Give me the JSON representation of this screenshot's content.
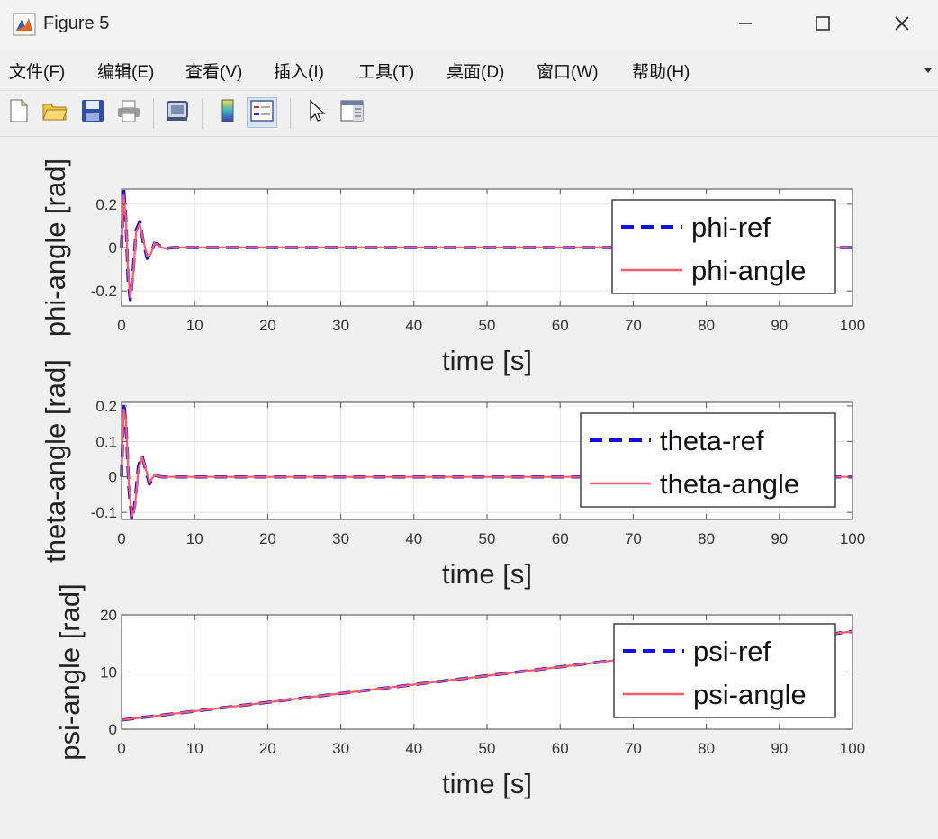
{
  "window": {
    "title": "Figure 5",
    "controls": {
      "minimize": "minimize-icon",
      "maximize": "maximize-icon",
      "close": "close-icon"
    }
  },
  "menu": [
    {
      "label": "文件(F)"
    },
    {
      "label": "编辑(E)"
    },
    {
      "label": "查看(V)"
    },
    {
      "label": "插入(I)"
    },
    {
      "label": "工具(T)"
    },
    {
      "label": "桌面(D)"
    },
    {
      "label": "窗口(W)"
    },
    {
      "label": "帮助(H)"
    }
  ],
  "toolbar": [
    {
      "icon": "new-figure-icon"
    },
    {
      "icon": "open-file-icon"
    },
    {
      "icon": "save-icon"
    },
    {
      "icon": "print-icon"
    },
    {
      "icon": "link-plot-icon"
    },
    {
      "icon": "insert-colorbar-icon"
    },
    {
      "icon": "insert-legend-icon",
      "pressed": true
    },
    {
      "icon": "edit-plot-icon"
    },
    {
      "icon": "open-property-inspector-icon"
    }
  ],
  "colors": {
    "ref": "#1010e0",
    "actual": "#ff5a6e",
    "axis": "#333333"
  },
  "chart_data": [
    {
      "type": "line",
      "xlabel": "time [s]",
      "ylabel": "phi-angle [rad]",
      "xlim": [
        0,
        100
      ],
      "ylim": [
        -0.27,
        0.27
      ],
      "xticks": [
        "0",
        "10",
        "20",
        "30",
        "40",
        "50",
        "60",
        "70",
        "80",
        "90",
        "100"
      ],
      "yticks": [
        {
          "v": 0.2,
          "t": "0.2"
        },
        {
          "v": 0,
          "t": "0"
        },
        {
          "v": -0.2,
          "t": "-0.2"
        }
      ],
      "grid": true,
      "legend_position": "top-right",
      "series": [
        {
          "name": "phi-ref",
          "style": "dashed",
          "color": "#1010e0",
          "x": [
            0,
            0.3,
            0.6,
            0.9,
            1.2,
            1.6,
            2,
            2.5,
            3,
            3.5,
            4,
            4.5,
            5,
            5.5,
            6,
            7,
            8,
            100
          ],
          "y": [
            0,
            0.27,
            0.12,
            -0.15,
            -0.24,
            -0.1,
            0.08,
            0.12,
            0.02,
            -0.05,
            -0.03,
            0.02,
            0.015,
            0,
            -0.005,
            0,
            0,
            0
          ]
        },
        {
          "name": "phi-angle",
          "style": "solid",
          "color": "#ff5a6e",
          "x": [
            0,
            0.3,
            0.6,
            0.9,
            1.2,
            1.6,
            2,
            2.5,
            3,
            3.5,
            4,
            4.5,
            5,
            5.5,
            6,
            7,
            8,
            100
          ],
          "y": [
            0,
            0.24,
            0.13,
            -0.12,
            -0.23,
            -0.12,
            0.07,
            0.11,
            0.03,
            -0.04,
            -0.03,
            0.02,
            0.012,
            0,
            -0.004,
            0,
            0,
            0
          ]
        }
      ]
    },
    {
      "type": "line",
      "xlabel": "time [s]",
      "ylabel": "theta-angle [rad]",
      "xlim": [
        0,
        100
      ],
      "ylim": [
        -0.12,
        0.21
      ],
      "xticks": [
        "0",
        "10",
        "20",
        "30",
        "40",
        "50",
        "60",
        "70",
        "80",
        "90",
        "100"
      ],
      "yticks": [
        {
          "v": 0.2,
          "t": "0.2"
        },
        {
          "v": 0.1,
          "t": "0.1"
        },
        {
          "v": 0,
          "t": "0"
        },
        {
          "v": -0.1,
          "t": "-0.1"
        }
      ],
      "grid": true,
      "legend_position": "top-right",
      "series": [
        {
          "name": "theta-ref",
          "style": "dashed",
          "color": "#1010e0",
          "x": [
            0,
            0.3,
            0.6,
            1,
            1.4,
            1.8,
            2.3,
            2.8,
            3.3,
            3.8,
            4.5,
            5.5,
            6.5,
            100
          ],
          "y": [
            0,
            0.21,
            0.15,
            -0.03,
            -0.12,
            -0.08,
            0.03,
            0.06,
            0.02,
            -0.02,
            0.005,
            0,
            0,
            0
          ]
        },
        {
          "name": "theta-angle",
          "style": "solid",
          "color": "#ff5a6e",
          "x": [
            0,
            0.3,
            0.6,
            1,
            1.4,
            1.8,
            2.3,
            2.8,
            3.3,
            3.8,
            4.5,
            5.5,
            6.5,
            100
          ],
          "y": [
            0,
            0.19,
            0.16,
            -0.02,
            -0.11,
            -0.09,
            0.02,
            0.055,
            0.025,
            -0.015,
            0.005,
            0,
            0,
            0
          ]
        }
      ]
    },
    {
      "type": "line",
      "xlabel": "time [s]",
      "ylabel": "psi-angle [rad]",
      "xlim": [
        0,
        100
      ],
      "ylim": [
        0,
        20
      ],
      "xticks": [
        "0",
        "10",
        "20",
        "30",
        "40",
        "50",
        "60",
        "70",
        "80",
        "90",
        "100"
      ],
      "yticks": [
        {
          "v": 20,
          "t": "20"
        },
        {
          "v": 10,
          "t": "10"
        },
        {
          "v": 0,
          "t": "0"
        }
      ],
      "grid": true,
      "legend_position": "top-right",
      "series": [
        {
          "name": "psi-ref",
          "style": "dashed",
          "color": "#1010e0",
          "x": [
            0,
            100
          ],
          "y": [
            1.6,
            17.1
          ]
        },
        {
          "name": "psi-angle",
          "style": "solid",
          "color": "#ff5a6e",
          "x": [
            0,
            100
          ],
          "y": [
            1.6,
            17.1
          ]
        }
      ]
    }
  ]
}
